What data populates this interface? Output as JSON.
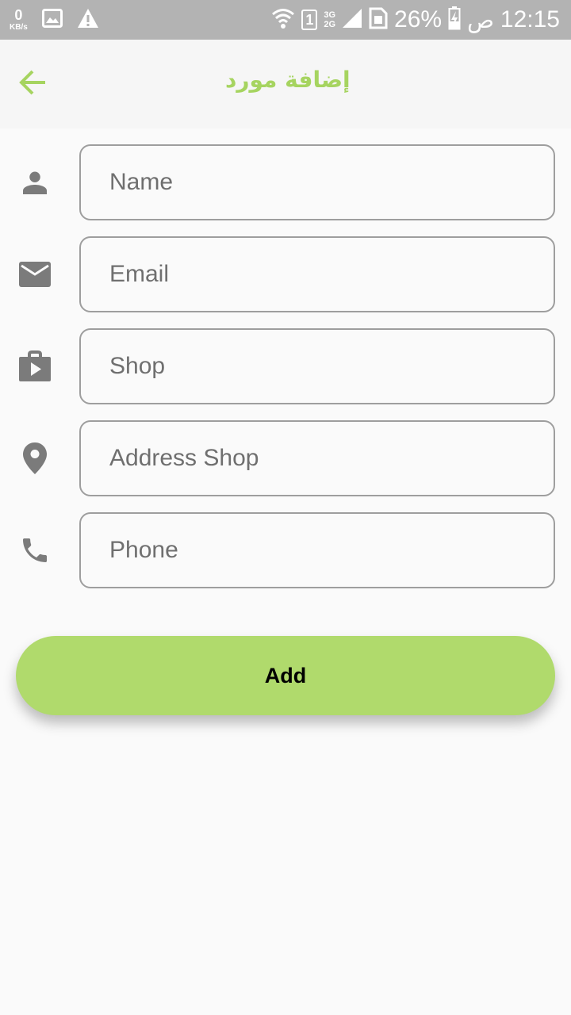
{
  "status_bar": {
    "net_speed_value": "0",
    "net_speed_unit": "KB/s",
    "sim_slot": "1",
    "net_type_top": "3G",
    "net_type_bottom": "2G",
    "battery": "26%",
    "ampm": "ص",
    "time": "12:15",
    "icons": [
      "image-icon",
      "warning-icon",
      "wifi-icon",
      "signal-icon",
      "sim-card-icon",
      "battery-charging-icon"
    ]
  },
  "app_bar": {
    "title": "إضافة مورد",
    "back_icon": "arrow-back-icon",
    "accent_color": "#a6d460"
  },
  "form": {
    "fields": [
      {
        "icon": "person-icon",
        "placeholder": "Name",
        "value": ""
      },
      {
        "icon": "mail-icon",
        "placeholder": "Email",
        "value": ""
      },
      {
        "icon": "shop-icon",
        "placeholder": "Shop",
        "value": ""
      },
      {
        "icon": "location-pin-icon",
        "placeholder": "Address Shop",
        "value": ""
      },
      {
        "icon": "phone-icon",
        "placeholder": "Phone",
        "value": ""
      }
    ]
  },
  "add_button": {
    "label": "Add",
    "color": "#b0da6c"
  }
}
